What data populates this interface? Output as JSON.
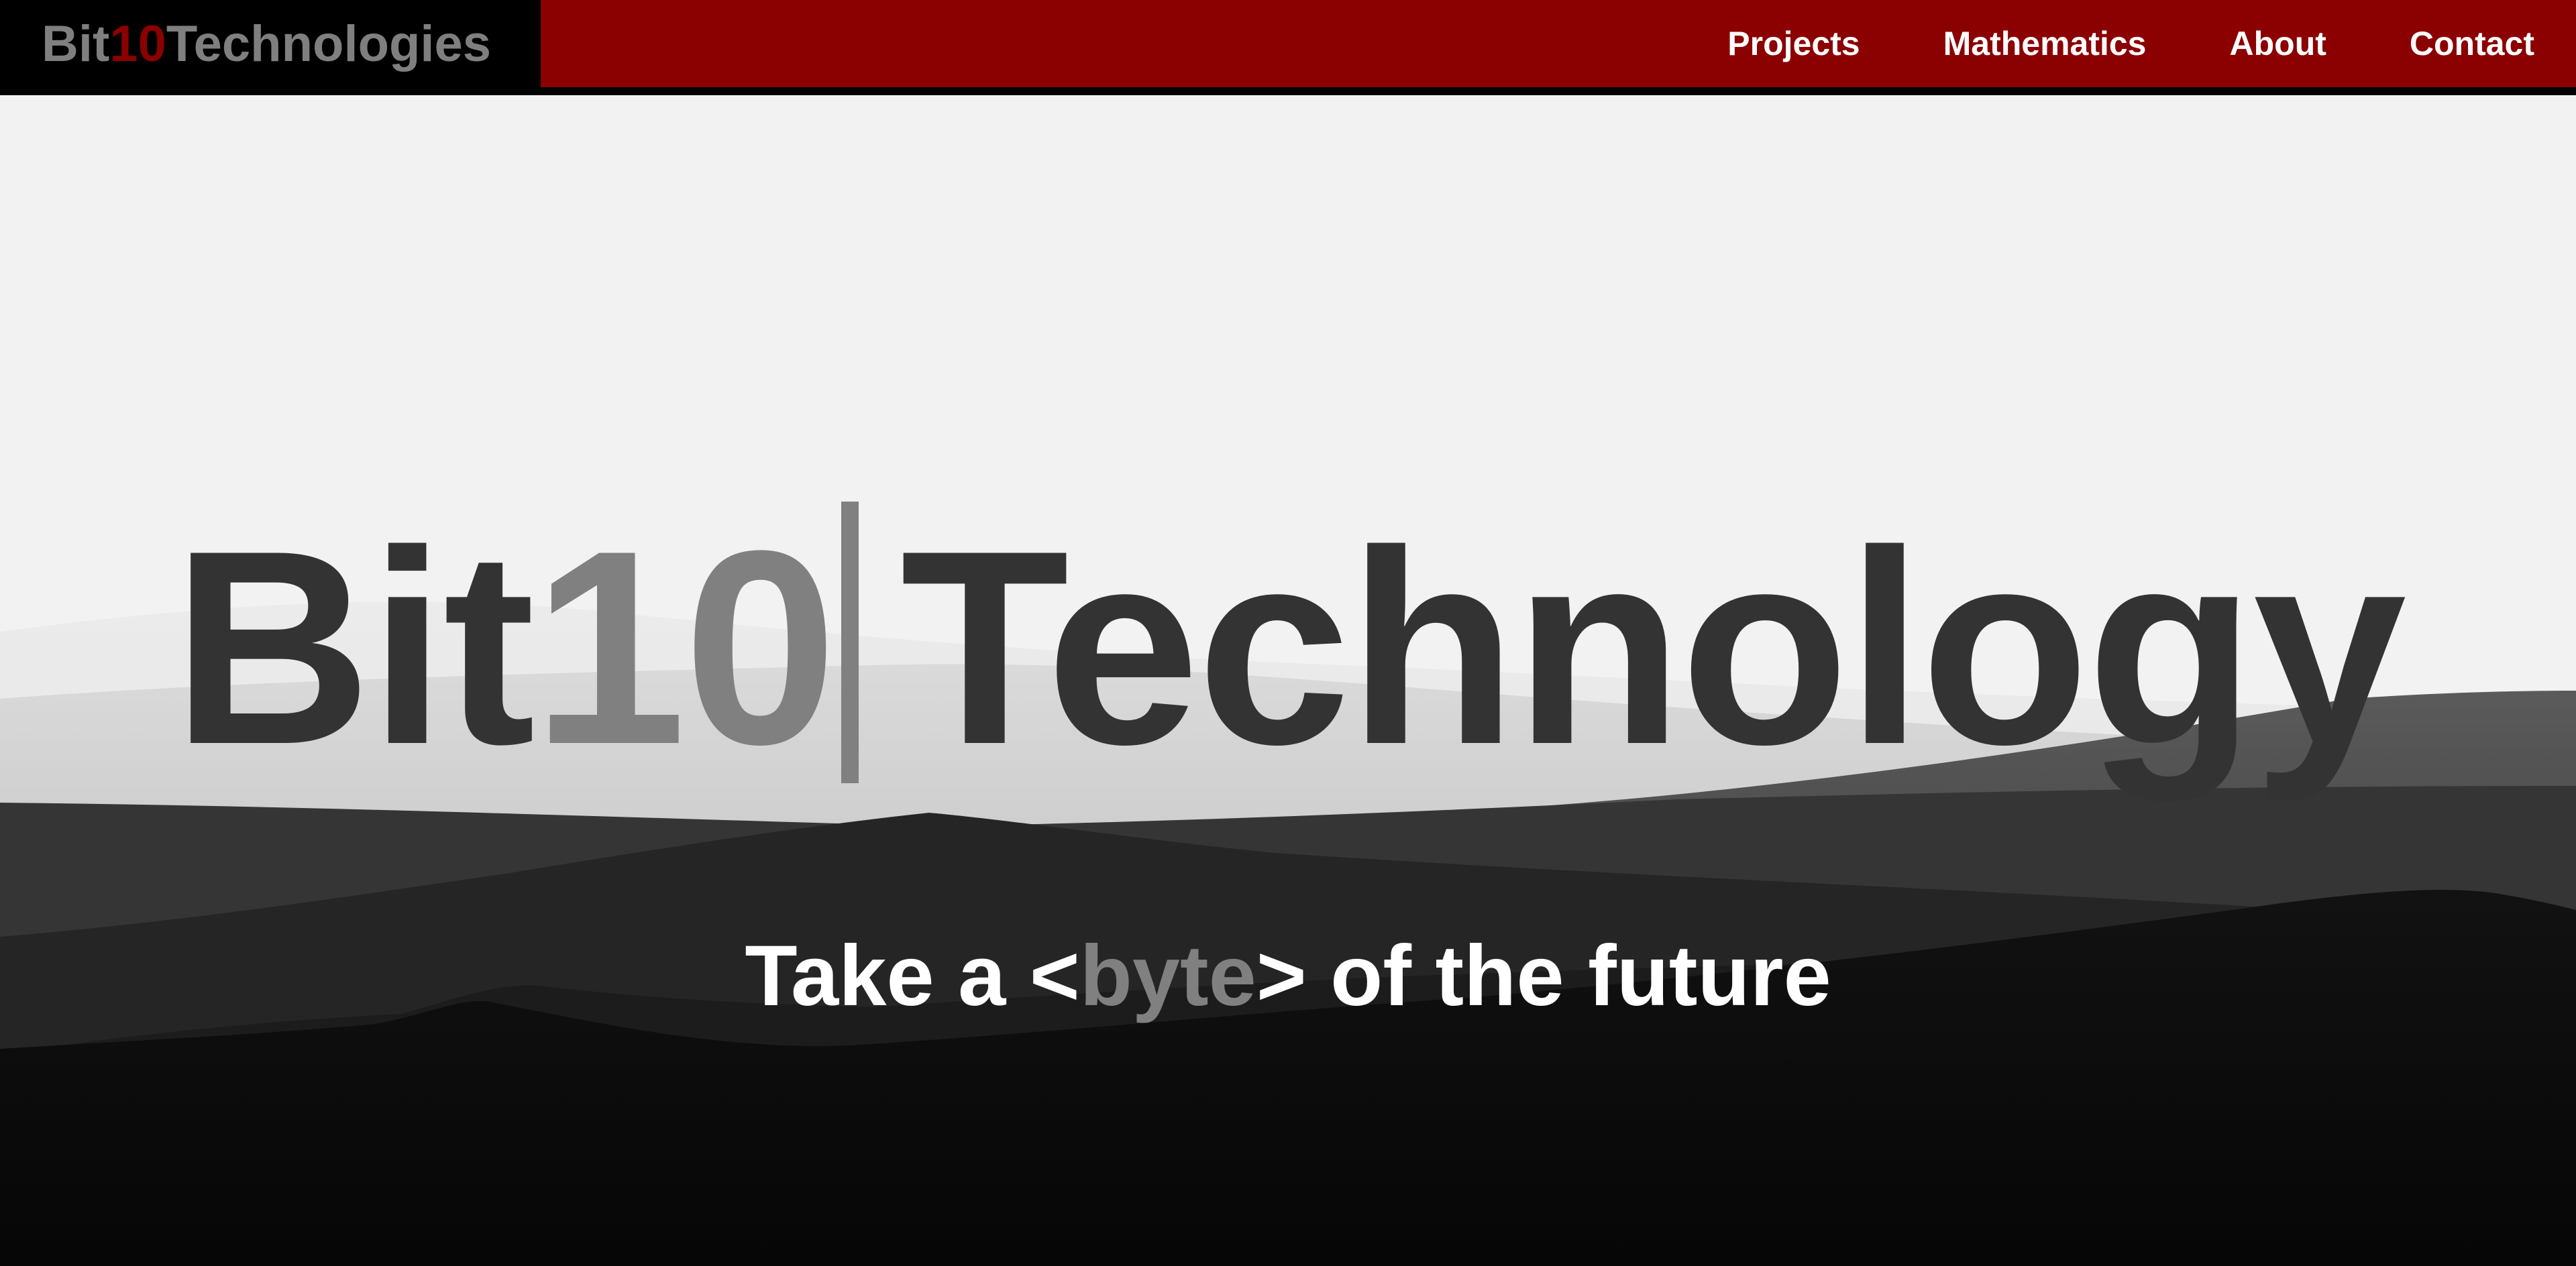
{
  "nav": {
    "brand": {
      "part1": "Bit",
      "part2": "10",
      "part3": " Technologies"
    },
    "links": [
      "Projects",
      "Mathematics",
      "About",
      "Contact"
    ]
  },
  "hero": {
    "title": {
      "part1": "Bit",
      "part2": "10",
      "part3": "Technology"
    },
    "tagline": {
      "prefix": "Take a <",
      "highlight": "byte",
      "suffix": "> of the future"
    }
  },
  "colors": {
    "nav_red": "#8b0000",
    "brand_red": "#8b0000",
    "accent_grey": "#808080",
    "title_dark": "#333333",
    "hero_bg": "#f2f2f2"
  }
}
